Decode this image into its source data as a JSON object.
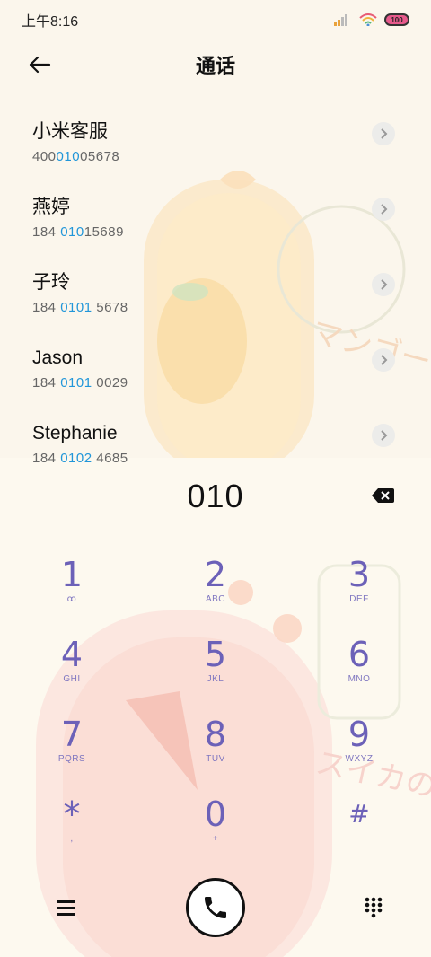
{
  "status_bar": {
    "time": "上午8:16",
    "battery": "100"
  },
  "header": {
    "title": "通话"
  },
  "contacts": [
    {
      "name": "小米客服",
      "number_pre": "400",
      "number_hl": "010",
      "number_post": "05678"
    },
    {
      "name": "燕婷",
      "number_pre": "184 ",
      "number_hl": "010",
      "number_post": "15689"
    },
    {
      "name": "子玲",
      "number_pre": "184 ",
      "number_hl": "0101",
      "number_post": " 5678"
    },
    {
      "name": "Jason",
      "number_pre": "184 ",
      "number_hl": "0101",
      "number_post": " 0029"
    },
    {
      "name": "Stephanie",
      "number_pre": "184 ",
      "number_hl": "0102",
      "number_post": " 4685"
    }
  ],
  "dialer": {
    "number": "010"
  },
  "keypad": [
    {
      "digit": "1",
      "letters": "ꝏ"
    },
    {
      "digit": "2",
      "letters": "ABC"
    },
    {
      "digit": "3",
      "letters": "DEF"
    },
    {
      "digit": "4",
      "letters": "GHI"
    },
    {
      "digit": "5",
      "letters": "JKL"
    },
    {
      "digit": "6",
      "letters": "MNO"
    },
    {
      "digit": "7",
      "letters": "PQRS"
    },
    {
      "digit": "8",
      "letters": "TUV"
    },
    {
      "digit": "9",
      "letters": "WXYZ"
    },
    {
      "digit": "*",
      "letters": ","
    },
    {
      "digit": "0",
      "letters": "+"
    },
    {
      "digit": "#",
      "letters": ""
    }
  ],
  "colors": {
    "accent_blue": "#2196d9",
    "keypad_purple": "#6c61b8",
    "background": "#fbf6ec"
  },
  "icons": {
    "back": "arrow-left-icon",
    "chevron": "chevron-right-icon",
    "backspace": "backspace-icon",
    "menu": "menu-icon",
    "call": "phone-icon",
    "keypad": "dialpad-icon"
  }
}
